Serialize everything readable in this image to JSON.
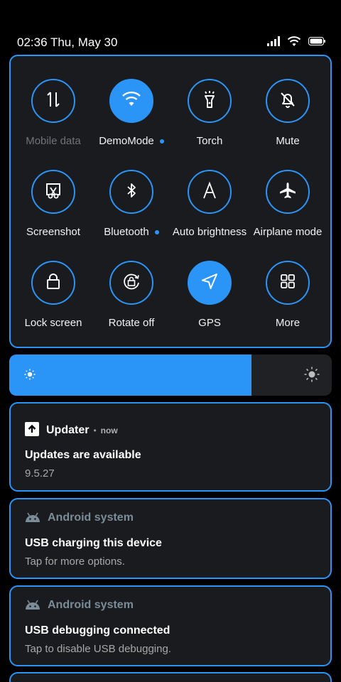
{
  "status_bar": {
    "time": "02:36",
    "date": "Thu, May 30",
    "icons": [
      "signal-icon",
      "wifi-icon",
      "battery-icon"
    ]
  },
  "quick_settings": {
    "tiles": [
      {
        "label": "Mobile data",
        "icon": "mobile-data-icon",
        "active": false,
        "dim": true
      },
      {
        "label": "DemoMode",
        "icon": "wifi-icon",
        "active": true,
        "dot": true
      },
      {
        "label": "Torch",
        "icon": "flashlight-icon",
        "active": false
      },
      {
        "label": "Mute",
        "icon": "bell-off-icon",
        "active": false
      },
      {
        "label": "Screenshot",
        "icon": "scissors-icon",
        "active": false
      },
      {
        "label": "Bluetooth",
        "icon": "bluetooth-icon",
        "active": false,
        "dot": true
      },
      {
        "label": "Auto brightness",
        "icon": "auto-brightness-icon",
        "active": false
      },
      {
        "label": "Airplane mode",
        "icon": "airplane-icon",
        "active": false
      },
      {
        "label": "Lock screen",
        "icon": "lock-icon",
        "active": false
      },
      {
        "label": "Rotate off",
        "icon": "rotate-lock-icon",
        "active": false
      },
      {
        "label": "GPS",
        "icon": "location-arrow-icon",
        "active": true
      },
      {
        "label": "More",
        "icon": "grid-icon",
        "active": false
      }
    ]
  },
  "brightness": {
    "level": 0.75
  },
  "notifications": [
    {
      "app": "Updater",
      "time_sep": "•",
      "time": "now",
      "title": "Updates are available",
      "text": "9.5.27"
    },
    {
      "app": "Android system",
      "title": "USB charging this device",
      "text": "Tap for more options."
    },
    {
      "app": "Android system",
      "title": "USB debugging connected",
      "text": "Tap to disable USB debugging."
    }
  ],
  "colors": {
    "accent": "#2b95f7",
    "panel": "#1a1b1e",
    "background": "#000000"
  }
}
